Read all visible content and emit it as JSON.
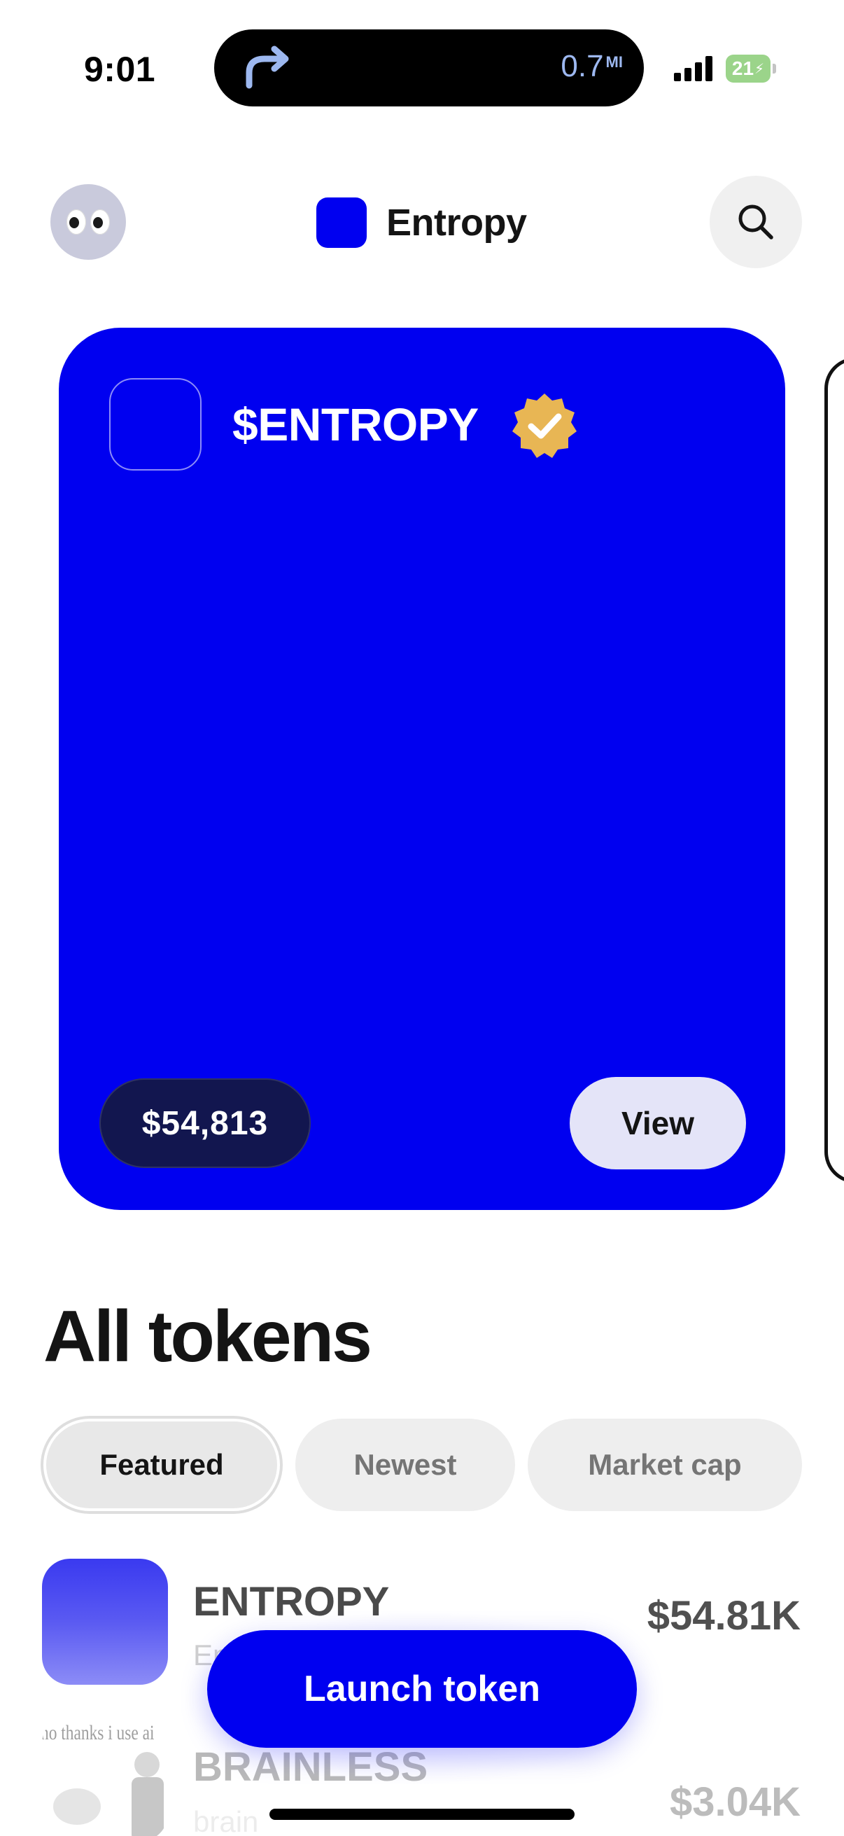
{
  "status_bar": {
    "time": "9:01",
    "navigation_distance": "0.7",
    "navigation_unit": "MI",
    "battery_percent": "21"
  },
  "header": {
    "avatar_icon": "eyes-emoji",
    "app_name": "Entropy",
    "search_icon": "search-icon"
  },
  "featured_card": {
    "title": "$ENTROPY",
    "verified": true,
    "price": "$54,813",
    "view_label": "View",
    "color": "#0000f0"
  },
  "tokens_section": {
    "title": "All tokens",
    "tabs": [
      {
        "label": "Featured",
        "selected": true
      },
      {
        "label": "Newest",
        "selected": false
      },
      {
        "label": "Market cap",
        "selected": false
      }
    ],
    "items": [
      {
        "name": "ENTROPY",
        "ticker": "En",
        "value": "$54.81K"
      },
      {
        "name": "BRAINLESS",
        "ticker": "brain",
        "value": "$3.04K",
        "thumb_text": "no thanks i use ai"
      }
    ]
  },
  "launch_button": {
    "label": "Launch token"
  },
  "colors": {
    "accent": "#0000f0",
    "price_pill": "#12164f",
    "view_button": "#e4e4f8",
    "tab_bg": "#eeeeee"
  }
}
